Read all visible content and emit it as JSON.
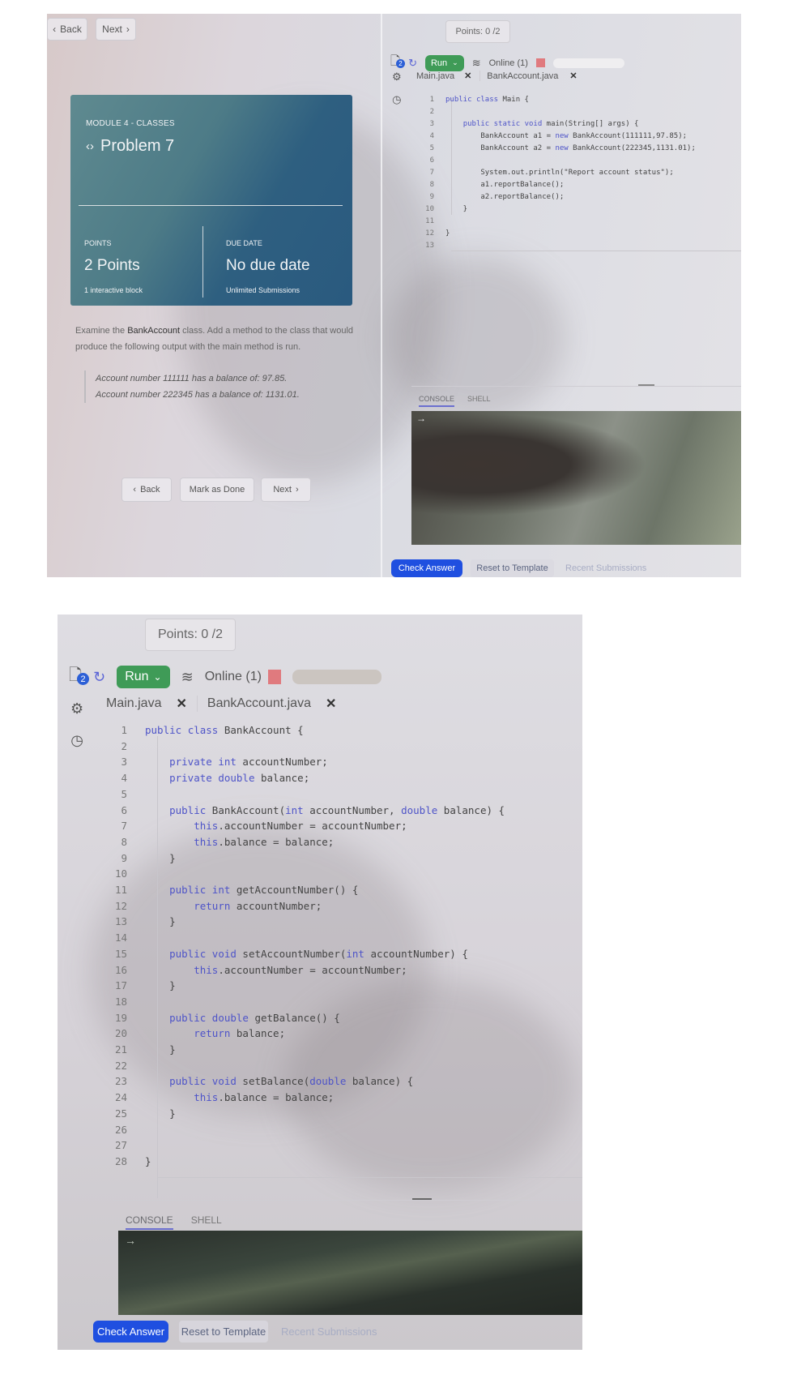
{
  "top_screenshot": {
    "nav": {
      "back_label": "Back",
      "next_label": "Next"
    },
    "card": {
      "module": "MODULE 4 - CLASSES",
      "title": "Problem 7",
      "points_label": "POINTS",
      "points_value": "2 Points",
      "points_sub": "1 interactive block",
      "due_label": "DUE DATE",
      "due_value": "No due date",
      "due_sub": "Unlimited Submissions"
    },
    "instructions": {
      "pre": "Examine the ",
      "bold": "BankAccount",
      "post": " class. Add a method to the class that would produce the following output with the main method is run."
    },
    "expected_output": [
      "Account number 111111 has a balance of: 97.85.",
      "Account number 222345 has a balance of: 1131.01."
    ],
    "footer_nav": {
      "back_label": "Back",
      "mark_done_label": "Mark as Done",
      "next_label": "Next"
    },
    "editor": {
      "points": "Points: 0 /2",
      "files_badge": "2",
      "run_label": "Run",
      "online_label": "Online (1)",
      "tabs": [
        {
          "label": "Main.java",
          "active": true
        },
        {
          "label": "BankAccount.java",
          "active": false
        }
      ],
      "code_lines": [
        "public class Main {",
        "",
        "    public static void main(String[] args) {",
        "        BankAccount a1 = new BankAccount(111111,97.85);",
        "        BankAccount a2 = new BankAccount(222345,1131.01);",
        "",
        "        System.out.println(\"Report account status\");",
        "        a1.reportBalance();",
        "        a2.reportBalance();",
        "    }",
        "",
        "}",
        ""
      ],
      "console_tabs": [
        "CONSOLE",
        "SHELL"
      ],
      "console_prompt": "→",
      "check_answer_label": "Check Answer",
      "reset_label": "Reset to Template",
      "recent_label": "Recent Submissions"
    }
  },
  "bottom_screenshot": {
    "editor": {
      "points": "Points: 0 /2",
      "files_badge": "2",
      "run_label": "Run",
      "online_label": "Online (1)",
      "tabs": [
        {
          "label": "Main.java",
          "active": false
        },
        {
          "label": "BankAccount.java",
          "active": true
        }
      ],
      "code_lines": [
        "public class BankAccount {",
        "",
        "    private int accountNumber;",
        "    private double balance;",
        "",
        "    public BankAccount(int accountNumber, double balance) {",
        "        this.accountNumber = accountNumber;",
        "        this.balance = balance;",
        "    }",
        "",
        "    public int getAccountNumber() {",
        "        return accountNumber;",
        "    }",
        "",
        "    public void setAccountNumber(int accountNumber) {",
        "        this.accountNumber = accountNumber;",
        "    }",
        "",
        "    public double getBalance() {",
        "        return balance;",
        "    }",
        "",
        "    public void setBalance(double balance) {",
        "        this.balance = balance;",
        "    }",
        "",
        "",
        "}"
      ],
      "console_tabs": [
        "CONSOLE",
        "SHELL"
      ],
      "console_prompt": "→",
      "check_answer_label": "Check Answer",
      "reset_label": "Reset to Template",
      "recent_label": "Recent Submissions"
    }
  },
  "colors": {
    "run_green": "#3f9b57",
    "primary_blue": "#1f4fe0",
    "keyword": "#4e54c8",
    "card_teal": "#2e5f80",
    "status_red": "#e07a7e"
  }
}
